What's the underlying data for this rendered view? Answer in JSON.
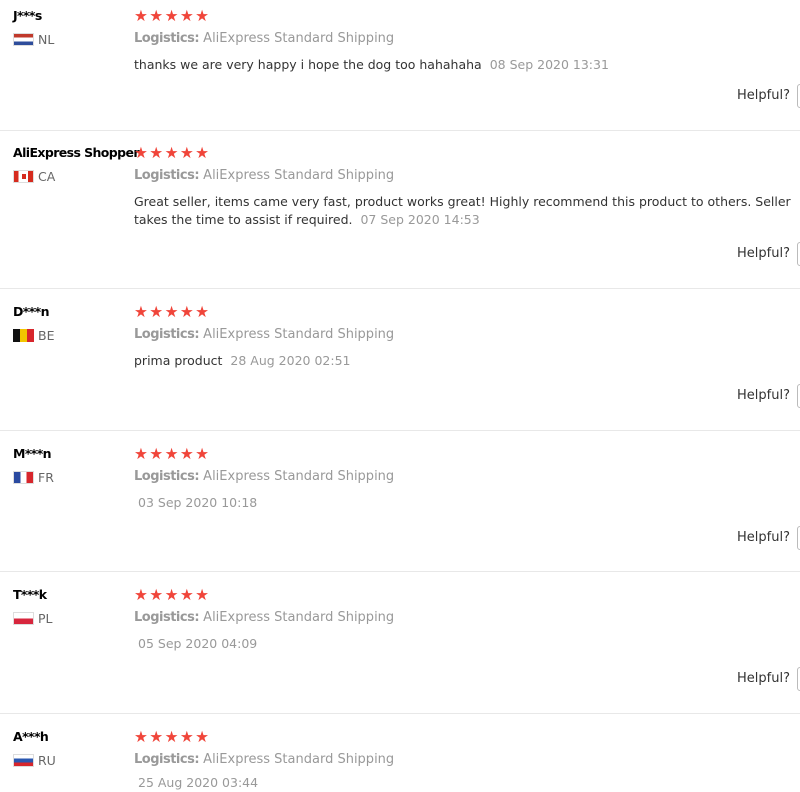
{
  "logistics_label": "Logistics:",
  "helpful_label": "Helpful?",
  "stars": "★★★★★",
  "reviews": [
    {
      "user": "J***s",
      "country": "NL",
      "logistics": "AliExpress Standard Shipping",
      "text": "thanks we are very happy i hope the dog too hahahaha",
      "date": "08 Sep 2020 13:31"
    },
    {
      "user": "AliExpress Shopper",
      "country": "CA",
      "logistics": "AliExpress Standard Shipping",
      "text": "Great seller, items came very fast, product works great! Highly recommend this product to others. Seller takes the time to assist if required.",
      "date": "07 Sep 2020 14:53"
    },
    {
      "user": "D***n",
      "country": "BE",
      "logistics": "AliExpress Standard Shipping",
      "text": "prima product",
      "date": "28 Aug 2020 02:51"
    },
    {
      "user": "M***n",
      "country": "FR",
      "logistics": "AliExpress Standard Shipping",
      "text": "",
      "date": "03 Sep 2020 10:18"
    },
    {
      "user": "T***k",
      "country": "PL",
      "logistics": "AliExpress Standard Shipping",
      "text": "",
      "date": "05 Sep 2020 04:09"
    },
    {
      "user": "A***h",
      "country": "RU",
      "logistics": "AliExpress Standard Shipping",
      "text": "",
      "date": "25 Aug 2020 03:44"
    }
  ]
}
